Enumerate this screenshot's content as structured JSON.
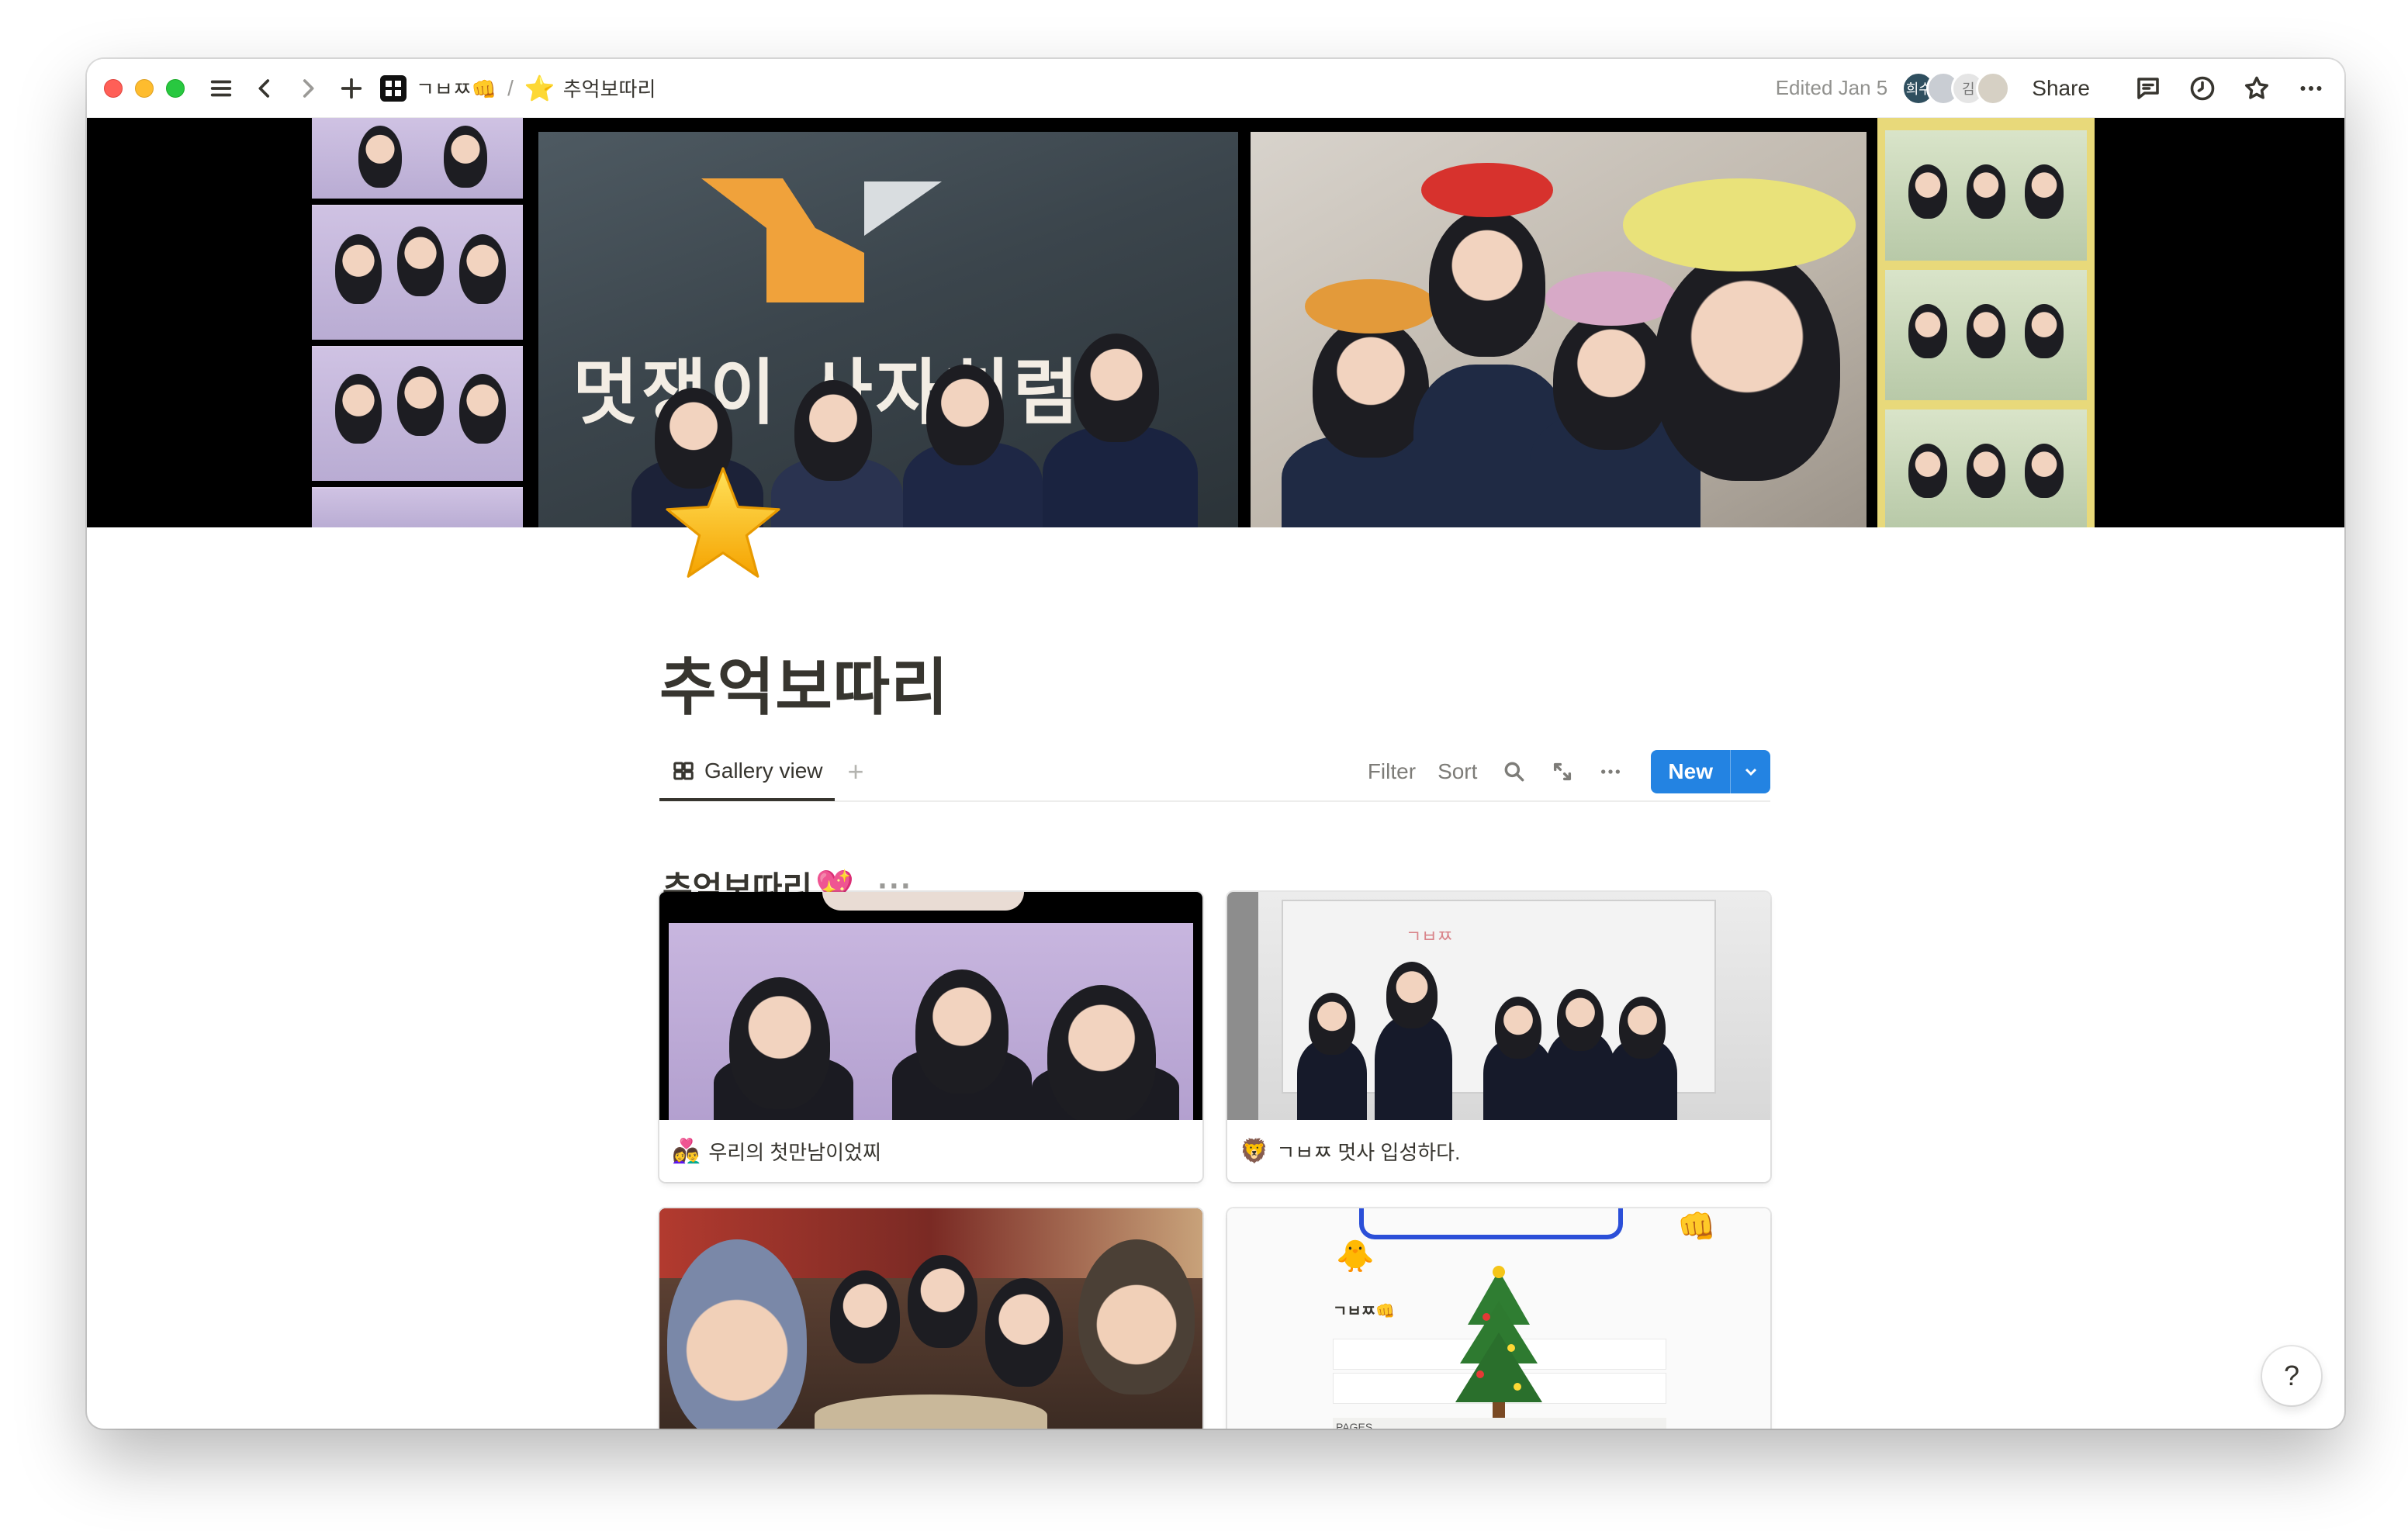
{
  "topbar": {
    "workspace": "ㄱㅂㅉ👊",
    "separator": "/",
    "page": "추억보따리",
    "edited": "Edited Jan 5",
    "avatars": [
      "희수",
      "",
      "김",
      ""
    ],
    "share": "Share"
  },
  "cover": {
    "sign": "멋쟁이 사자처럼"
  },
  "page": {
    "title": "추억보따리"
  },
  "viewbar": {
    "tab": "Gallery view",
    "add": "+",
    "filter": "Filter",
    "sort": "Sort",
    "new_label": "New"
  },
  "database": {
    "title": "추억보따리",
    "heart": "💖",
    "more": "···"
  },
  "cards": [
    {
      "emoji": "👩‍❤️‍👨",
      "title": "우리의 첫만남이었찌"
    },
    {
      "emoji": "🦁",
      "title": "ㄱㅂㅉ 멋사 입성하다."
    },
    {
      "emoji": "",
      "title": ""
    },
    {
      "emoji": "",
      "title": ""
    }
  ],
  "card4_preview": {
    "heading": "ㄱㅂㅉ👊",
    "pages_label": "PAGES"
  },
  "help": "?",
  "colors": {
    "accent": "#2383e2",
    "text": "#37352f",
    "muted": "#7d7c78"
  }
}
